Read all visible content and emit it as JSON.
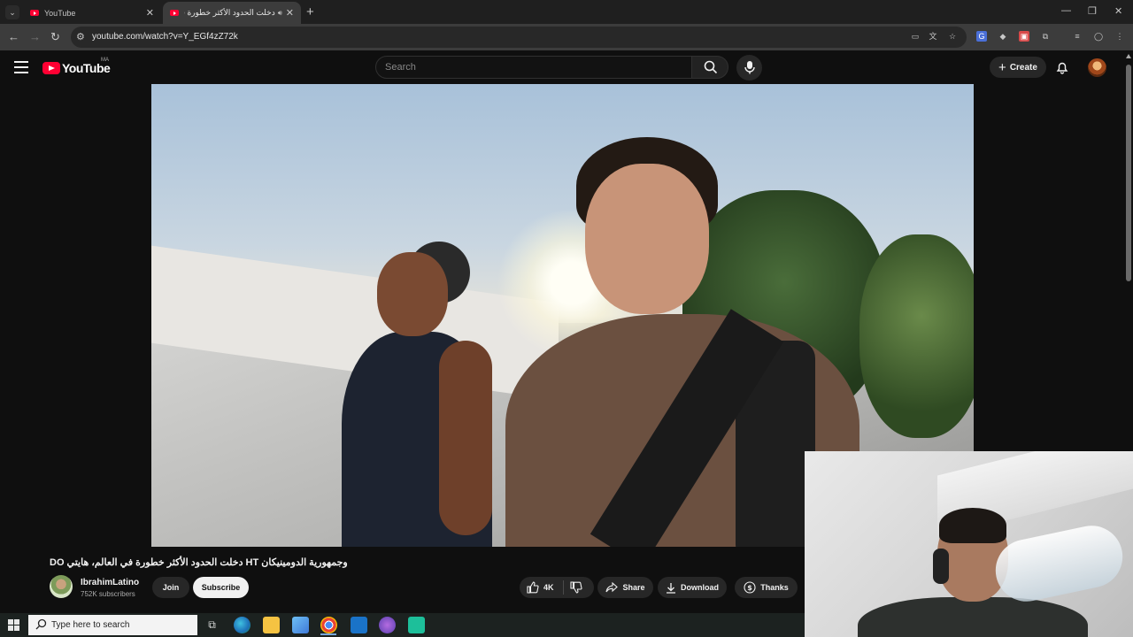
{
  "browser": {
    "tabs": [
      {
        "title": "YouTube",
        "active": false
      },
      {
        "title": "دخلت الحدود الأكثر خطورة ف",
        "active": true
      }
    ],
    "url": "youtube.com/watch?v=Y_EGf4zZ72k"
  },
  "youtube": {
    "logo_text": "YouTube",
    "country_code": "MA",
    "search_placeholder": "Search",
    "create_label": "Create"
  },
  "video": {
    "title": "وجمهورية الدومينيكان HT دخلت الحدود الأكثر خطورة في العالم، هايتي DO",
    "channel_name": "IbrahimLatino",
    "subscribers": "752K subscribers",
    "join_label": "Join",
    "subscribe_label": "Subscribe",
    "like_count": "4K",
    "share_label": "Share",
    "download_label": "Download",
    "thanks_label": "Thanks"
  },
  "taskbar": {
    "search_placeholder": "Type here to search"
  },
  "colors": {
    "youtube_red": "#ff0033",
    "background": "#0f0f0f",
    "button_bg": "#272727"
  }
}
